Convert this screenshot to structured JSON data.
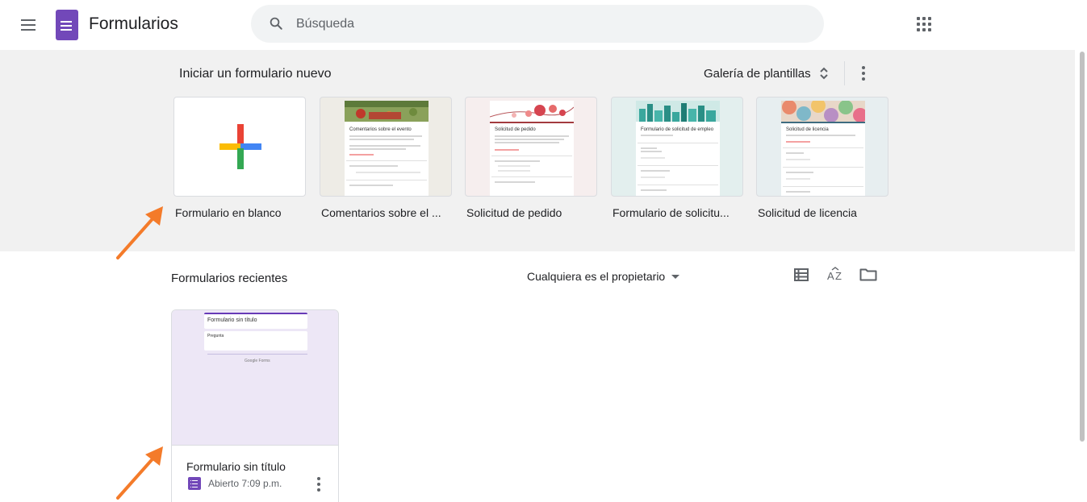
{
  "header": {
    "app_title": "Formularios",
    "search_placeholder": "Búsqueda"
  },
  "templates": {
    "section_title": "Iniciar un formulario nuevo",
    "gallery_label": "Galería de plantillas",
    "items": [
      {
        "label": "Formulario en blanco"
      },
      {
        "label": "Comentarios sobre el ...",
        "preview_title": "Comentarios sobre el evento"
      },
      {
        "label": "Solicitud de pedido",
        "preview_title": "Solicitud de pedido"
      },
      {
        "label": "Formulario de solicitu...",
        "preview_title": "Formulario de solicitud de empleo"
      },
      {
        "label": "Solicitud de licencia",
        "preview_title": "Solicitud de licencia"
      }
    ]
  },
  "recent": {
    "section_title": "Formularios recientes",
    "owner_filter": "Cualquiera es el propietario",
    "documents": [
      {
        "name": "Formulario sin título",
        "meta": "Abierto 7:09 p.m.",
        "preview_title": "Formulario sin título",
        "preview_question": "Pregunta",
        "preview_brand": "Google Forms"
      }
    ]
  },
  "colors": {
    "forms_purple": "#7248b9",
    "annotation_orange": "#f47b2a"
  }
}
